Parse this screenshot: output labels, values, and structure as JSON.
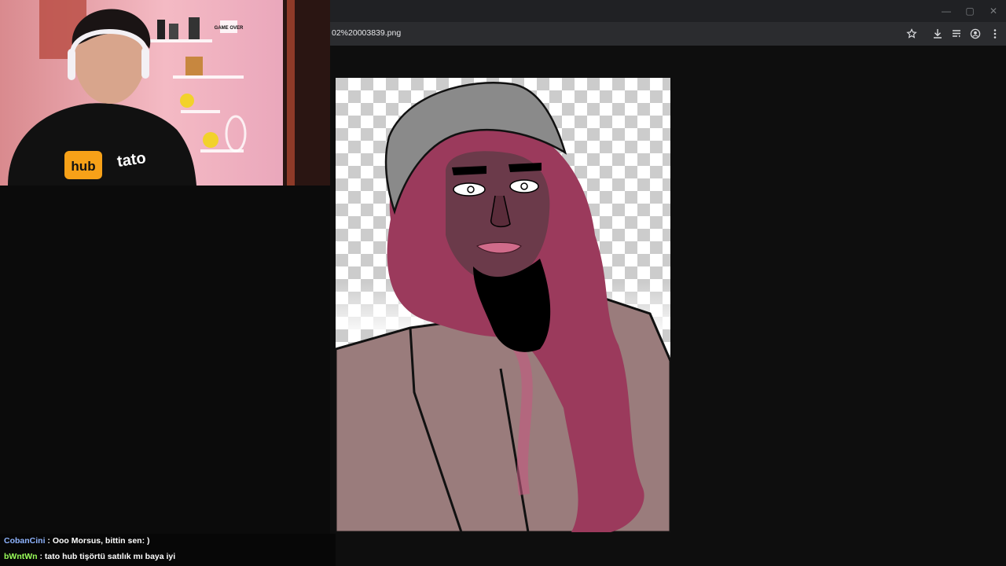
{
  "browser": {
    "url_text": "02%20003839.png",
    "window_controls": {
      "minimize": "—",
      "maximize": "▢",
      "close": "✕"
    },
    "toolbar_icons": [
      "star-icon",
      "download-icon",
      "reading-list-icon",
      "profile-icon",
      "menu-icon"
    ]
  },
  "webcam": {
    "shirt_text_left": "hub",
    "shirt_text_right": "tato",
    "sticker_text": "GAME OVER"
  },
  "chat": {
    "messages": [
      {
        "user": "CobanCini",
        "user_color": "#8fb4ff",
        "separator": " : ",
        "text": "Ooo Morsus, bittin sen: )"
      },
      {
        "user": "bWntWn",
        "user_color": "#9aff5a",
        "separator": " : ",
        "text": "tato hub tişörtü satılık mı baya iyi"
      }
    ]
  },
  "colors": {
    "browser_bg": "#0e0e0e",
    "titlebar": "#202124",
    "toolbar": "#2b2c2f",
    "skin": "#6b3a4a",
    "hair": "#9b3a5c",
    "hat": "#8a8a8a",
    "coat": "#9a7c7c"
  }
}
